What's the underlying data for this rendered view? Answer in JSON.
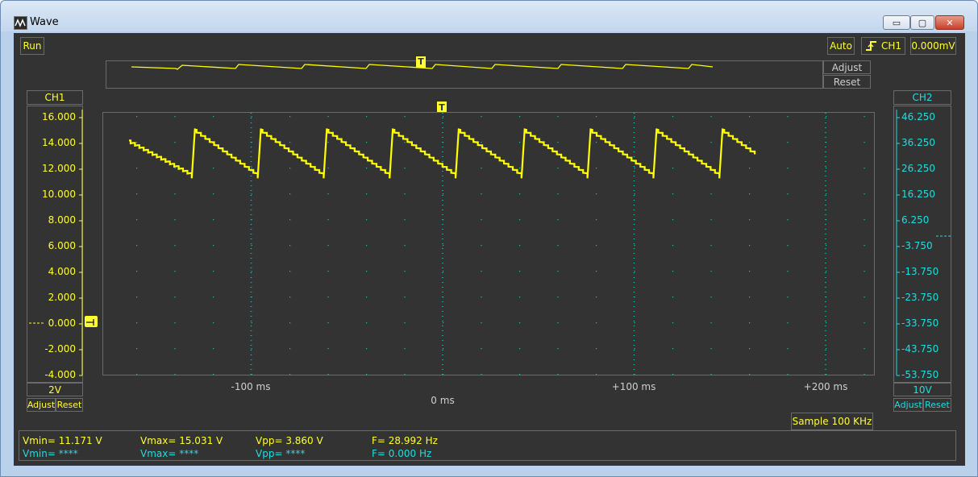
{
  "window": {
    "title": "Wave",
    "min_glyph": "▭",
    "max_glyph": "▢",
    "close_glyph": "✕"
  },
  "toolbar": {
    "run_label": "Run",
    "auto_label": "Auto",
    "trigger_channel": "CH1",
    "trigger_level": "0.000mV"
  },
  "overview": {
    "adjust_label": "Adjust",
    "reset_label": "Reset",
    "trigger_marker": "T"
  },
  "ch1": {
    "label": "CH1",
    "scale": "2V",
    "adjust_label": "Adjust",
    "reset_label": "Reset",
    "ticks": [
      "16.000",
      "14.000",
      "12.000",
      "10.000",
      "8.000",
      "6.000",
      "4.000",
      "2.000",
      "0.000",
      "-2.000",
      "-4.000"
    ]
  },
  "ch2": {
    "label": "CH2",
    "scale": "10V",
    "adjust_label": "Adjust",
    "reset_label": "Reset",
    "ticks": [
      "46.250",
      "36.250",
      "26.250",
      "16.250",
      "6.250",
      "-3.750",
      "-13.750",
      "-23.750",
      "-33.750",
      "-43.750",
      "-53.750"
    ]
  },
  "plot": {
    "trigger_marker": "T",
    "time_labels": [
      "-100 ms",
      "0 ms",
      "+100 ms",
      "+200 ms"
    ],
    "trace": {
      "color": "#ffff00",
      "vmin": 11.171,
      "vmax": 15.031,
      "frequency_hz": 28.992
    }
  },
  "sample_label": "Sample 100 KHz",
  "stats": {
    "ch1": {
      "vmin": "Vmin= 11.171 V",
      "vmax": "Vmax= 15.031 V",
      "vpp": "Vpp= 3.860 V",
      "f": "F= 28.992 Hz"
    },
    "ch2": {
      "vmin": "Vmin= ****",
      "vmax": "Vmax= ****",
      "vpp": "Vpp= ****",
      "f": "F= 0.000 Hz"
    }
  },
  "colors": {
    "ch1": "#ffff33",
    "ch2": "#22dddd",
    "background": "#333333",
    "grid": "#22bbbb"
  }
}
